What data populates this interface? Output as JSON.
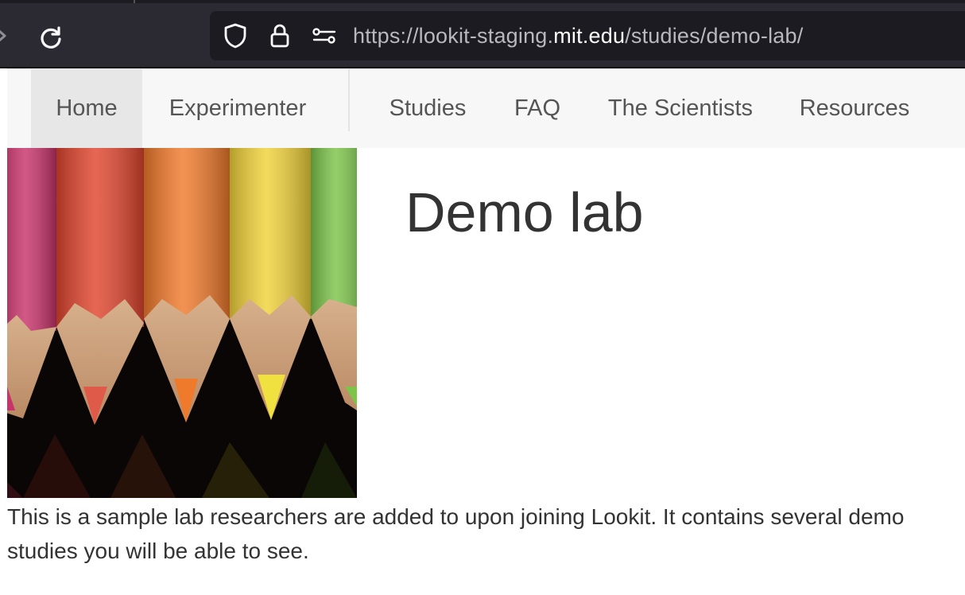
{
  "browser": {
    "url_prefix": "https://lookit-staging.",
    "url_host": "mit.edu",
    "url_path": "/studies/demo-lab/",
    "icons": [
      "forward-icon",
      "reload-icon",
      "shield-icon",
      "lock-icon",
      "permissions-icon"
    ]
  },
  "nav": {
    "items": [
      {
        "label": "Home",
        "active": true
      },
      {
        "label": "Experimenter"
      },
      {
        "label": "Studies"
      },
      {
        "label": "FAQ"
      },
      {
        "label": "The Scientists"
      },
      {
        "label": "Resources"
      }
    ]
  },
  "lab": {
    "title": "Demo lab",
    "description": "This is a sample lab researchers are added to upon joining Lookit. It contains several demo studies you will be able to see.",
    "image_subject": "colored-pencils",
    "pencil_colors": [
      "#c8336a",
      "#e0452e",
      "#f07a2c",
      "#f0d23a",
      "#7cc44a"
    ]
  },
  "colors": {
    "chrome_bg": "#2b2a33",
    "urlbar_bg": "#1c1b22",
    "nav_bg": "#f7f7f7",
    "nav_active_bg": "#e7e7e7",
    "text": "#333333"
  }
}
